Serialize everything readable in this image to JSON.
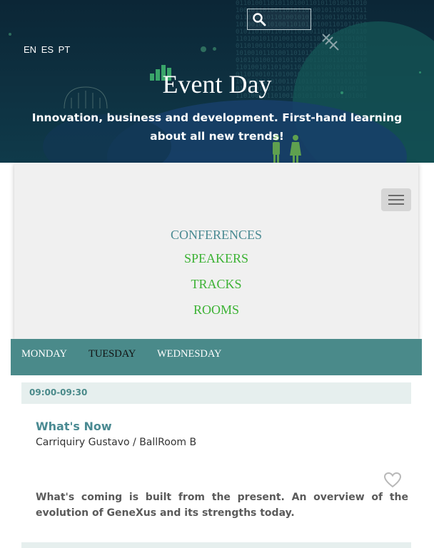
{
  "header": {
    "languages": [
      "EN",
      "ES",
      "PT"
    ],
    "title": "Event Day",
    "subtitle": "Innovation, business and development. First-hand learning about all new trends!",
    "search_icon": "search-icon"
  },
  "nav": {
    "menu_icon": "hamburger-menu-icon",
    "items": [
      {
        "label": "CONFERENCES",
        "active": true
      },
      {
        "label": "SPEAKERS",
        "active": false
      },
      {
        "label": "TRACKS",
        "active": false
      },
      {
        "label": "ROOMS",
        "active": false
      }
    ]
  },
  "days": {
    "tabs": [
      {
        "label": "MONDAY",
        "selected": false
      },
      {
        "label": "TUESDAY",
        "selected": true
      },
      {
        "label": "WEDNESDAY",
        "selected": false
      }
    ]
  },
  "sessions": [
    {
      "time": "09:00-09:30",
      "title": "What's Now",
      "speaker_room": "Carriquiry Gustavo / BallRoom B",
      "favorite_icon": "heart-outline-icon",
      "description": "What's coming is built from the present. An overview of the evolution of GeneXus and its strengths today."
    }
  ],
  "colors": {
    "teal": "#4a8a8a",
    "nav_green": "#3cb234",
    "nav_active": "#4a8a92",
    "hero_bg": "#0e3141"
  }
}
